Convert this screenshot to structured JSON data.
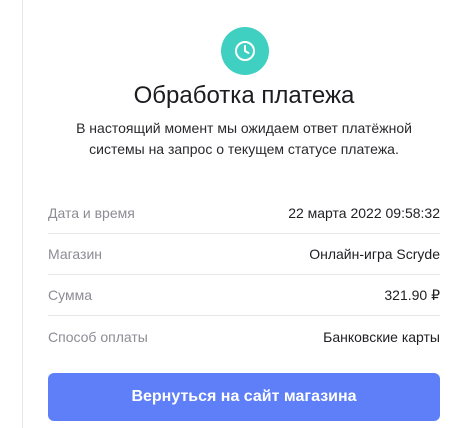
{
  "status": {
    "icon": "clock-icon",
    "icon_color": "#3fd0c1",
    "title": "Обработка платежа",
    "description": "В настоящий момент мы ожидаем ответ платёжной системы на запрос о текущем статусе платежа."
  },
  "details": [
    {
      "label": "Дата и время",
      "value": "22 марта 2022 09:58:32"
    },
    {
      "label": "Магазин",
      "value": "Онлайн-игра Scryde"
    },
    {
      "label": "Сумма",
      "value": "321.90 ₽"
    },
    {
      "label": "Способ оплаты",
      "value": "Банковские карты"
    }
  ],
  "actions": {
    "return_label": "Вернуться на сайт магазина",
    "button_color": "#5e7ff7"
  }
}
